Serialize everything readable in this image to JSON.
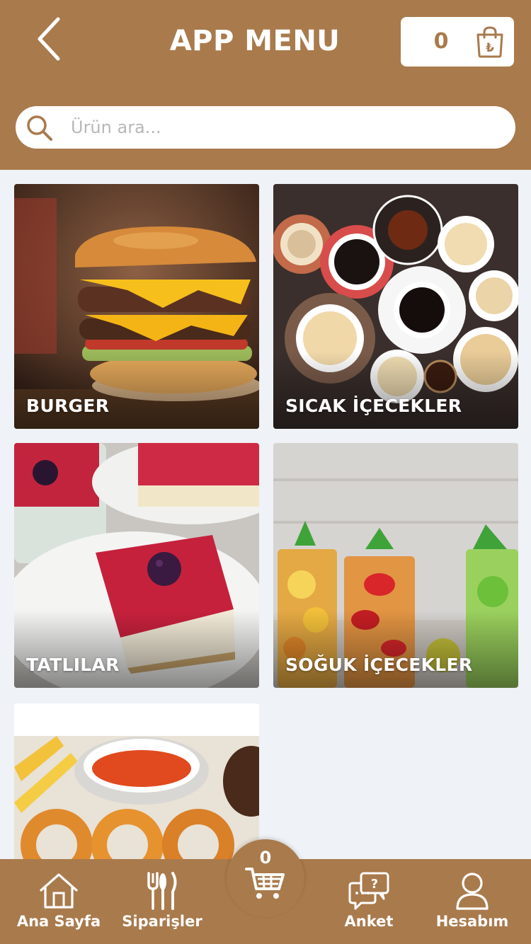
{
  "header": {
    "title": "APP MENU",
    "cart_count": "0",
    "back_icon": "chevron-left-icon",
    "bag_icon": "shopping-bag-lira-icon"
  },
  "search": {
    "placeholder": "Ürün ara...",
    "value": "",
    "icon": "search-icon"
  },
  "categories": [
    {
      "label": "BURGER",
      "image": "burger-photo"
    },
    {
      "label": "SICAK İÇECEKLER",
      "image": "hot-drinks-photo"
    },
    {
      "label": "TATLILAR",
      "image": "dessert-photo"
    },
    {
      "label": "SOĞUK İÇECEKLER",
      "image": "cold-drinks-photo"
    },
    {
      "label": "",
      "image": "appetizers-photo"
    }
  ],
  "bottom_nav": {
    "home": "Ana Sayfa",
    "orders": "Siparişler",
    "cart_count": "0",
    "survey": "Anket",
    "account": "Hesabım"
  },
  "colors": {
    "brand": "#a97a4c",
    "background": "#eff2f6",
    "white": "#ffffff"
  }
}
